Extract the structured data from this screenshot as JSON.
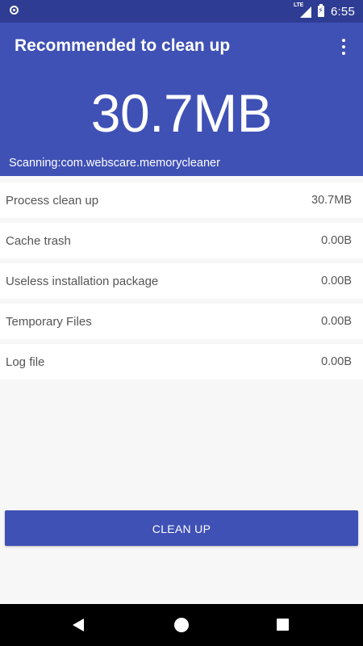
{
  "status_bar": {
    "network_label": "LTE",
    "time": "6:55"
  },
  "app_bar": {
    "title": "Recommended to clean up"
  },
  "summary": {
    "total_size": "30.7MB",
    "scanning_text": "Scanning:com.webscare.memorycleaner"
  },
  "items": [
    {
      "label": "Process clean up",
      "value": "30.7MB"
    },
    {
      "label": "Cache trash",
      "value": "0.00B"
    },
    {
      "label": "Useless installation package",
      "value": "0.00B"
    },
    {
      "label": "Temporary Files",
      "value": "0.00B"
    },
    {
      "label": "Log file",
      "value": "0.00B"
    }
  ],
  "actions": {
    "clean_up_label": "CLEAN UP"
  },
  "colors": {
    "primary": "#3f51b5",
    "primary_dark": "#2e3c93",
    "background": "#f7f7f7"
  }
}
